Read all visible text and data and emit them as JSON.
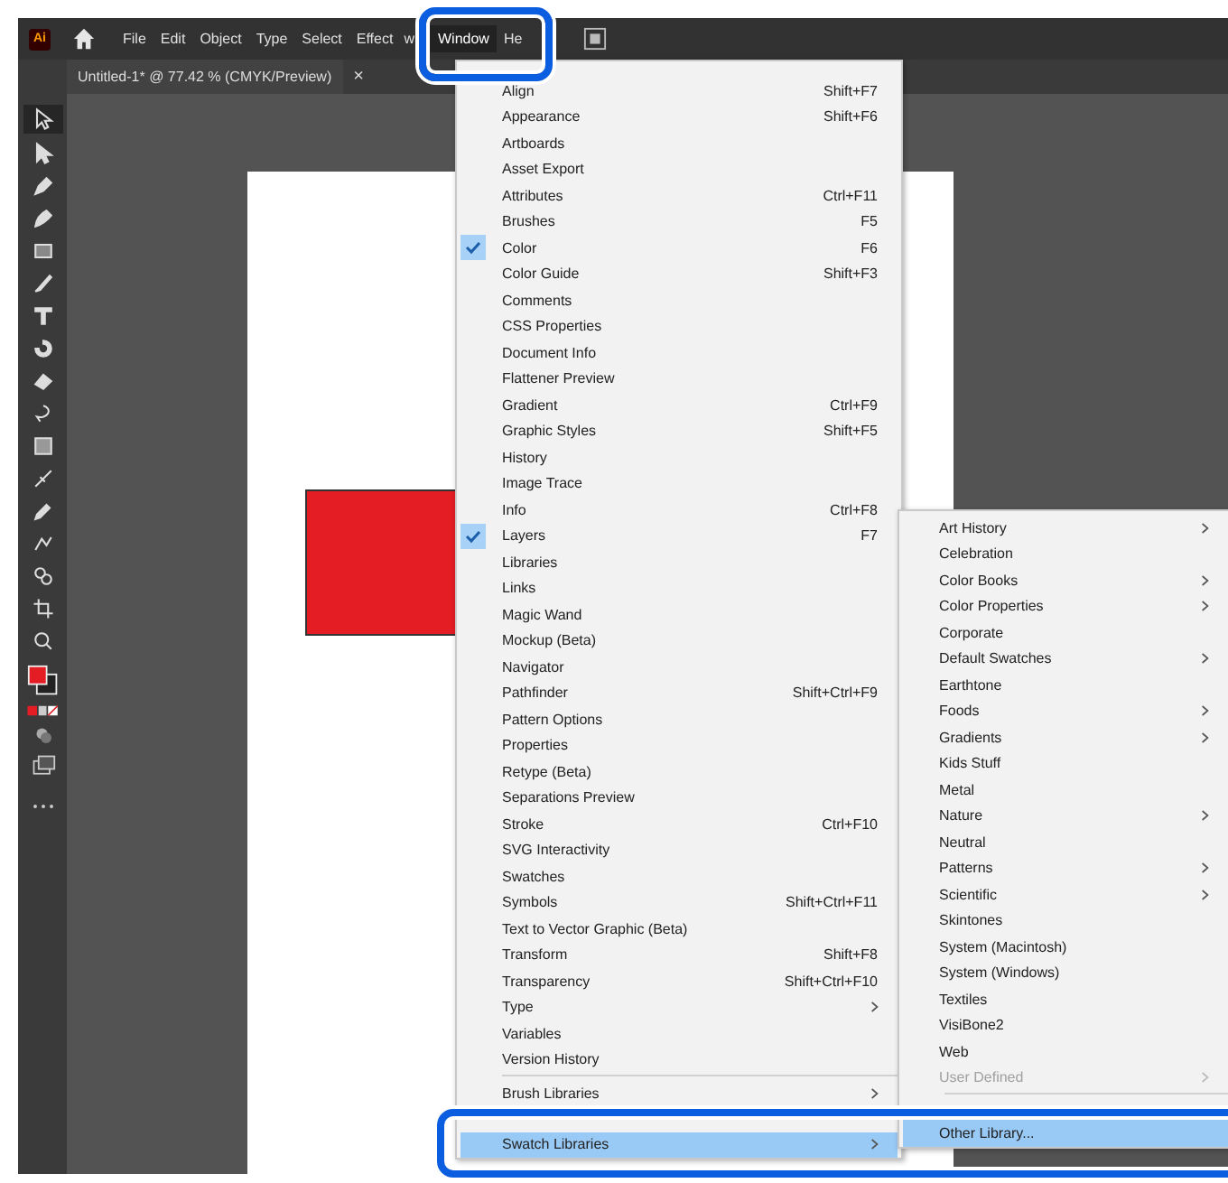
{
  "app_logo": "Ai",
  "menu_bar": [
    {
      "label": "File",
      "selected": false
    },
    {
      "label": "Edit",
      "selected": false
    },
    {
      "label": "Object",
      "selected": false
    },
    {
      "label": "Type",
      "selected": false
    },
    {
      "label": "Select",
      "selected": false
    },
    {
      "label": "Effect",
      "selected": false
    },
    {
      "label": "w",
      "selected": false
    },
    {
      "label": "Window",
      "selected": true
    },
    {
      "label": "He",
      "selected": false
    }
  ],
  "document_tab": {
    "title": "Untitled-1* @ 77.42 % (CMYK/Preview)",
    "close": "×"
  },
  "window_menu": {
    "items": [
      {
        "kind": "item",
        "label": "Align",
        "shortcut": "Shift+F7",
        "checked": false,
        "submenu": false,
        "selected": false
      },
      {
        "kind": "item",
        "label": "Appearance",
        "shortcut": "Shift+F6",
        "checked": false,
        "submenu": false,
        "selected": false
      },
      {
        "kind": "item",
        "label": "Artboards",
        "checked": false,
        "submenu": false,
        "selected": false
      },
      {
        "kind": "item",
        "label": "Asset Export",
        "checked": false,
        "submenu": false,
        "selected": false
      },
      {
        "kind": "item",
        "label": "Attributes",
        "shortcut": "Ctrl+F11",
        "checked": false,
        "submenu": false,
        "selected": false
      },
      {
        "kind": "item",
        "label": "Brushes",
        "shortcut": "F5",
        "checked": false,
        "submenu": false,
        "selected": false
      },
      {
        "kind": "item",
        "label": "Color",
        "shortcut": "F6",
        "checked": true,
        "submenu": false,
        "selected": false
      },
      {
        "kind": "item",
        "label": "Color Guide",
        "shortcut": "Shift+F3",
        "checked": false,
        "submenu": false,
        "selected": false
      },
      {
        "kind": "item",
        "label": "Comments",
        "checked": false,
        "submenu": false,
        "selected": false
      },
      {
        "kind": "item",
        "label": "CSS Properties",
        "checked": false,
        "submenu": false,
        "selected": false
      },
      {
        "kind": "item",
        "label": "Document Info",
        "checked": false,
        "submenu": false,
        "selected": false
      },
      {
        "kind": "item",
        "label": "Flattener Preview",
        "checked": false,
        "submenu": false,
        "selected": false
      },
      {
        "kind": "item",
        "label": "Gradient",
        "shortcut": "Ctrl+F9",
        "checked": false,
        "submenu": false,
        "selected": false
      },
      {
        "kind": "item",
        "label": "Graphic Styles",
        "shortcut": "Shift+F5",
        "checked": false,
        "submenu": false,
        "selected": false
      },
      {
        "kind": "item",
        "label": "History",
        "checked": false,
        "submenu": false,
        "selected": false
      },
      {
        "kind": "item",
        "label": "Image Trace",
        "checked": false,
        "submenu": false,
        "selected": false
      },
      {
        "kind": "item",
        "label": "Info",
        "shortcut": "Ctrl+F8",
        "checked": false,
        "submenu": false,
        "selected": false
      },
      {
        "kind": "item",
        "label": "Layers",
        "shortcut": "F7",
        "checked": true,
        "submenu": false,
        "selected": false
      },
      {
        "kind": "item",
        "label": "Libraries",
        "checked": false,
        "submenu": false,
        "selected": false
      },
      {
        "kind": "item",
        "label": "Links",
        "checked": false,
        "submenu": false,
        "selected": false
      },
      {
        "kind": "item",
        "label": "Magic Wand",
        "checked": false,
        "submenu": false,
        "selected": false
      },
      {
        "kind": "item",
        "label": "Mockup (Beta)",
        "checked": false,
        "submenu": false,
        "selected": false
      },
      {
        "kind": "item",
        "label": "Navigator",
        "checked": false,
        "submenu": false,
        "selected": false
      },
      {
        "kind": "item",
        "label": "Pathfinder",
        "shortcut": "Shift+Ctrl+F9",
        "checked": false,
        "submenu": false,
        "selected": false
      },
      {
        "kind": "item",
        "label": "Pattern Options",
        "checked": false,
        "submenu": false,
        "selected": false
      },
      {
        "kind": "item",
        "label": "Properties",
        "checked": false,
        "submenu": false,
        "selected": false
      },
      {
        "kind": "item",
        "label": "Retype (Beta)",
        "checked": false,
        "submenu": false,
        "selected": false
      },
      {
        "kind": "item",
        "label": "Separations Preview",
        "checked": false,
        "submenu": false,
        "selected": false
      },
      {
        "kind": "item",
        "label": "Stroke",
        "shortcut": "Ctrl+F10",
        "checked": false,
        "submenu": false,
        "selected": false
      },
      {
        "kind": "item",
        "label": "SVG Interactivity",
        "checked": false,
        "submenu": false,
        "selected": false
      },
      {
        "kind": "item",
        "label": "Swatches",
        "checked": false,
        "submenu": false,
        "selected": false
      },
      {
        "kind": "item",
        "label": "Symbols",
        "shortcut": "Shift+Ctrl+F11",
        "checked": false,
        "submenu": false,
        "selected": false
      },
      {
        "kind": "item",
        "label": "Text to Vector Graphic (Beta)",
        "checked": false,
        "submenu": false,
        "selected": false
      },
      {
        "kind": "item",
        "label": "Transform",
        "shortcut": "Shift+F8",
        "checked": false,
        "submenu": false,
        "selected": false
      },
      {
        "kind": "item",
        "label": "Transparency",
        "shortcut": "Shift+Ctrl+F10",
        "checked": false,
        "submenu": false,
        "selected": false
      },
      {
        "kind": "item",
        "label": "Type",
        "checked": false,
        "submenu": true,
        "selected": false
      },
      {
        "kind": "item",
        "label": "Variables",
        "checked": false,
        "submenu": false,
        "selected": false
      },
      {
        "kind": "item",
        "label": "Version History",
        "checked": false,
        "submenu": false,
        "selected": false
      },
      {
        "kind": "separator"
      },
      {
        "kind": "item",
        "label": "Brush Libraries",
        "checked": false,
        "submenu": true,
        "selected": false
      },
      {
        "kind": "item",
        "label": "Swatch Libraries",
        "checked": false,
        "submenu": true,
        "selected": true
      }
    ]
  },
  "swatch_libraries_submenu": {
    "items": [
      {
        "kind": "item",
        "label": "Art History",
        "submenu": true,
        "disabled": false,
        "selected": false
      },
      {
        "kind": "item",
        "label": "Celebration",
        "submenu": false,
        "disabled": false,
        "selected": false
      },
      {
        "kind": "item",
        "label": "Color Books",
        "submenu": true,
        "disabled": false,
        "selected": false
      },
      {
        "kind": "item",
        "label": "Color Properties",
        "submenu": true,
        "disabled": false,
        "selected": false
      },
      {
        "kind": "item",
        "label": "Corporate",
        "submenu": false,
        "disabled": false,
        "selected": false
      },
      {
        "kind": "item",
        "label": "Default Swatches",
        "submenu": true,
        "disabled": false,
        "selected": false
      },
      {
        "kind": "item",
        "label": "Earthtone",
        "submenu": false,
        "disabled": false,
        "selected": false
      },
      {
        "kind": "item",
        "label": "Foods",
        "submenu": true,
        "disabled": false,
        "selected": false
      },
      {
        "kind": "item",
        "label": "Gradients",
        "submenu": true,
        "disabled": false,
        "selected": false
      },
      {
        "kind": "item",
        "label": "Kids Stuff",
        "submenu": false,
        "disabled": false,
        "selected": false
      },
      {
        "kind": "item",
        "label": "Metal",
        "submenu": false,
        "disabled": false,
        "selected": false
      },
      {
        "kind": "item",
        "label": "Nature",
        "submenu": true,
        "disabled": false,
        "selected": false
      },
      {
        "kind": "item",
        "label": "Neutral",
        "submenu": false,
        "disabled": false,
        "selected": false
      },
      {
        "kind": "item",
        "label": "Patterns",
        "submenu": true,
        "disabled": false,
        "selected": false
      },
      {
        "kind": "item",
        "label": "Scientific",
        "submenu": true,
        "disabled": false,
        "selected": false
      },
      {
        "kind": "item",
        "label": "Skintones",
        "submenu": false,
        "disabled": false,
        "selected": false
      },
      {
        "kind": "item",
        "label": "System (Macintosh)",
        "submenu": false,
        "disabled": false,
        "selected": false
      },
      {
        "kind": "item",
        "label": "System (Windows)",
        "submenu": false,
        "disabled": false,
        "selected": false
      },
      {
        "kind": "item",
        "label": "Textiles",
        "submenu": false,
        "disabled": false,
        "selected": false
      },
      {
        "kind": "item",
        "label": "VisiBone2",
        "submenu": false,
        "disabled": false,
        "selected": false
      },
      {
        "kind": "item",
        "label": "Web",
        "submenu": false,
        "disabled": false,
        "selected": false
      },
      {
        "kind": "item",
        "label": "User Defined",
        "submenu": true,
        "disabled": true,
        "selected": false
      },
      {
        "kind": "separator"
      },
      {
        "kind": "item",
        "label": "Other Library...",
        "submenu": false,
        "disabled": false,
        "selected": true
      }
    ]
  }
}
